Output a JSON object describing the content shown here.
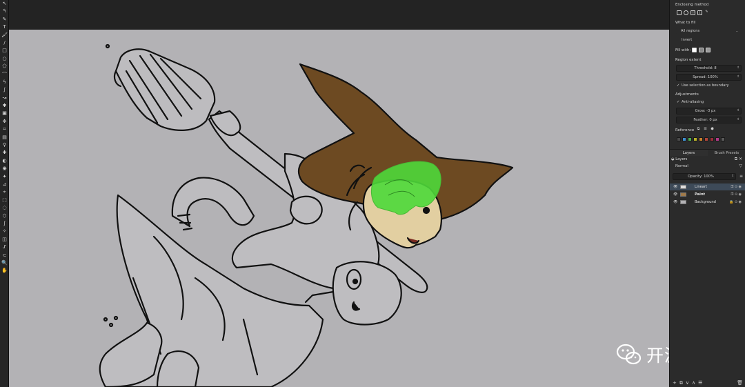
{
  "toolbox": {
    "tools": [
      {
        "name": "select-shapes-icon",
        "glyph": "↖"
      },
      {
        "name": "edit-shapes-icon",
        "glyph": "↰"
      },
      {
        "name": "calligraphy-icon",
        "glyph": "✎"
      },
      {
        "name": "text-icon",
        "glyph": "T"
      },
      {
        "name": "freehand-brush-icon",
        "glyph": "🖌"
      },
      {
        "name": "line-icon",
        "glyph": "/"
      },
      {
        "name": "rectangle-icon",
        "glyph": "□"
      },
      {
        "name": "ellipse-icon",
        "glyph": "○"
      },
      {
        "name": "polygon-icon",
        "glyph": "⬠"
      },
      {
        "name": "polyline-icon",
        "glyph": "⌒"
      },
      {
        "name": "bezier-icon",
        "glyph": "ϟ"
      },
      {
        "name": "freehand-path-icon",
        "glyph": "∫"
      },
      {
        "name": "dynamic-brush-icon",
        "glyph": "↝"
      },
      {
        "name": "multibrush-icon",
        "glyph": "✱"
      },
      {
        "name": "transform-icon",
        "glyph": "▣"
      },
      {
        "name": "move-icon",
        "glyph": "✥"
      },
      {
        "name": "crop-icon",
        "glyph": "⌗"
      },
      {
        "name": "gradient-icon",
        "glyph": "▤"
      },
      {
        "name": "color-picker-icon",
        "glyph": "⚲"
      },
      {
        "name": "smart-patch-icon",
        "glyph": "✚"
      },
      {
        "name": "fill-icon",
        "glyph": "◐"
      },
      {
        "name": "enclose-and-fill-icon",
        "glyph": "◉"
      },
      {
        "name": "assistant-icon",
        "glyph": "✦"
      },
      {
        "name": "measure-icon",
        "glyph": "⊿"
      },
      {
        "name": "reference-icon",
        "glyph": "⌖"
      },
      {
        "name": "rect-select-icon",
        "glyph": "⬚"
      },
      {
        "name": "ellipse-select-icon",
        "glyph": "◌"
      },
      {
        "name": "polygon-select-icon",
        "glyph": "⬡"
      },
      {
        "name": "freehand-select-icon",
        "glyph": "ʃ"
      },
      {
        "name": "contiguous-select-icon",
        "glyph": "✧"
      },
      {
        "name": "similar-select-icon",
        "glyph": "◫"
      },
      {
        "name": "bezier-select-icon",
        "glyph": "ᔑ"
      },
      {
        "name": "magnetic-select-icon",
        "glyph": "⊂"
      },
      {
        "name": "zoom-icon",
        "glyph": "🔍"
      },
      {
        "name": "pan-icon",
        "glyph": "✋"
      }
    ]
  },
  "tool_options": {
    "enclosing_method_label": "Enclosing method",
    "what_to_fill_label": "What to fill",
    "what_to_fill_value": "All regions",
    "invert_label": "Invert",
    "fill_with_label": "Fill with:",
    "region_extent_label": "Region extent",
    "threshold": "Threshold: 8",
    "spread": "Spread: 100%",
    "use_selection_label": "Use selection as boundary",
    "adjustments_label": "Adjustments",
    "anti_aliasing_label": "Anti-aliasing",
    "grow": "Grow: -3 px",
    "feather": "Feather: 0 px",
    "reference_label": "Reference",
    "swatches": [
      "#4a4a4a",
      "#3f8fd0",
      "#4caf50",
      "#b8b02a",
      "#c9822d",
      "#b0453a",
      "#9a2f3a",
      "#b23a8a",
      "#5a5a5a"
    ]
  },
  "layers": {
    "tab_layers": "Layers",
    "tab_brush_presets": "Brush Presets",
    "title": "Layers",
    "blend_mode": "Normal",
    "opacity": "Opacity: 100%",
    "rows": [
      {
        "name": "Lineart",
        "active": true
      },
      {
        "name": "Paint",
        "active": false
      },
      {
        "name": "Background",
        "active": false
      }
    ]
  },
  "watermark": {
    "text": "开源日记",
    "logo": "wechat-logo-icon"
  },
  "colors": {
    "canvas": "#b3b2b5",
    "hat": "#6d4a22",
    "skin": "#e2cfa1",
    "selection": "#4ed83a"
  }
}
